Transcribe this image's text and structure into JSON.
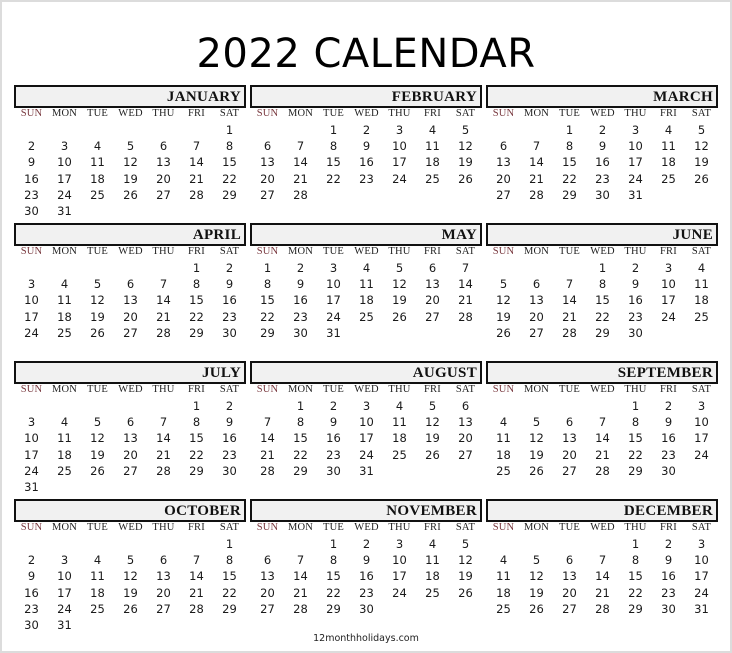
{
  "title": "2022 CALENDAR",
  "footer": "12monthholidays.com",
  "weekdays": [
    "SUN",
    "MON",
    "TUE",
    "WED",
    "THU",
    "FRI",
    "SAT"
  ],
  "colors": {
    "sunday_label": "#7a3a40",
    "header_fill": "#f1f1f1",
    "header_border": "#111111"
  },
  "months": [
    {
      "name": "JANUARY",
      "start": 6,
      "days": 31
    },
    {
      "name": "FEBRUARY",
      "start": 2,
      "days": 28
    },
    {
      "name": "MARCH",
      "start": 2,
      "days": 31
    },
    {
      "name": "APRIL",
      "start": 5,
      "days": 30
    },
    {
      "name": "MAY",
      "start": 0,
      "days": 31
    },
    {
      "name": "JUNE",
      "start": 3,
      "days": 30
    },
    {
      "name": "JULY",
      "start": 5,
      "days": 31
    },
    {
      "name": "AUGUST",
      "start": 1,
      "days": 31
    },
    {
      "name": "SEPTEMBER",
      "start": 4,
      "days": 30
    },
    {
      "name": "OCTOBER",
      "start": 6,
      "days": 31
    },
    {
      "name": "NOVEMBER",
      "start": 2,
      "days": 30
    },
    {
      "name": "DECEMBER",
      "start": 4,
      "days": 31
    }
  ]
}
